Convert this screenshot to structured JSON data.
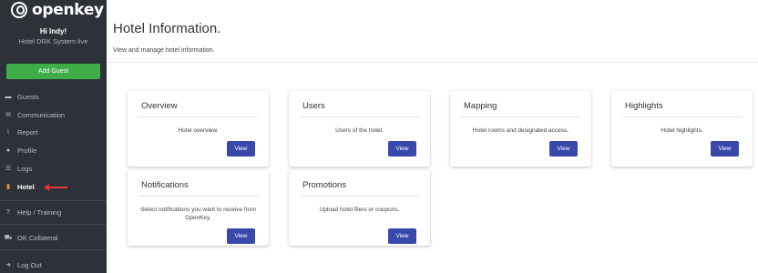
{
  "sidebar": {
    "brand": "openkey",
    "greeting": "Hi Indy!",
    "subtitle": "Hotel DRK System live",
    "add_guest": "Add Guest",
    "items": [
      {
        "label": "Guests",
        "icon": "bed-icon"
      },
      {
        "label": "Communication",
        "icon": "envelope-icon"
      },
      {
        "label": "Report",
        "icon": "chart-icon"
      },
      {
        "label": "Profile",
        "icon": "user-icon"
      },
      {
        "label": "Logs",
        "icon": "list-icon"
      },
      {
        "label": "Hotel",
        "icon": "building-icon",
        "active": true
      },
      {
        "label": "Help / Training",
        "icon": "question-icon"
      },
      {
        "label": "OK Collateral",
        "icon": "cart-icon"
      },
      {
        "label": "Log Out",
        "icon": "logout-icon"
      }
    ]
  },
  "main": {
    "title": "Hotel Information.",
    "subtitle": "View and manage hotel information."
  },
  "cards": [
    {
      "title": "Overview",
      "desc": "Hotel overview.",
      "button": "View"
    },
    {
      "title": "Users",
      "desc": "Users of the hotel.",
      "button": "View"
    },
    {
      "title": "Mapping",
      "desc": "Hotel rooms and designated access.",
      "button": "View"
    },
    {
      "title": "Highlights",
      "desc": "Hotel highlights.",
      "button": "View"
    },
    {
      "title": "Notifications",
      "desc": "Select notifications you want to receive from OpenKey.",
      "button": "View"
    },
    {
      "title": "Promotions",
      "desc": "Upload hotel fliers or coupons.",
      "button": "View"
    }
  ],
  "colors": {
    "sidebar_bg": "#2d3238",
    "add_guest": "#3fae49",
    "button": "#3939ab",
    "active_icon": "#f08a4b",
    "arrow": "#e53935"
  }
}
